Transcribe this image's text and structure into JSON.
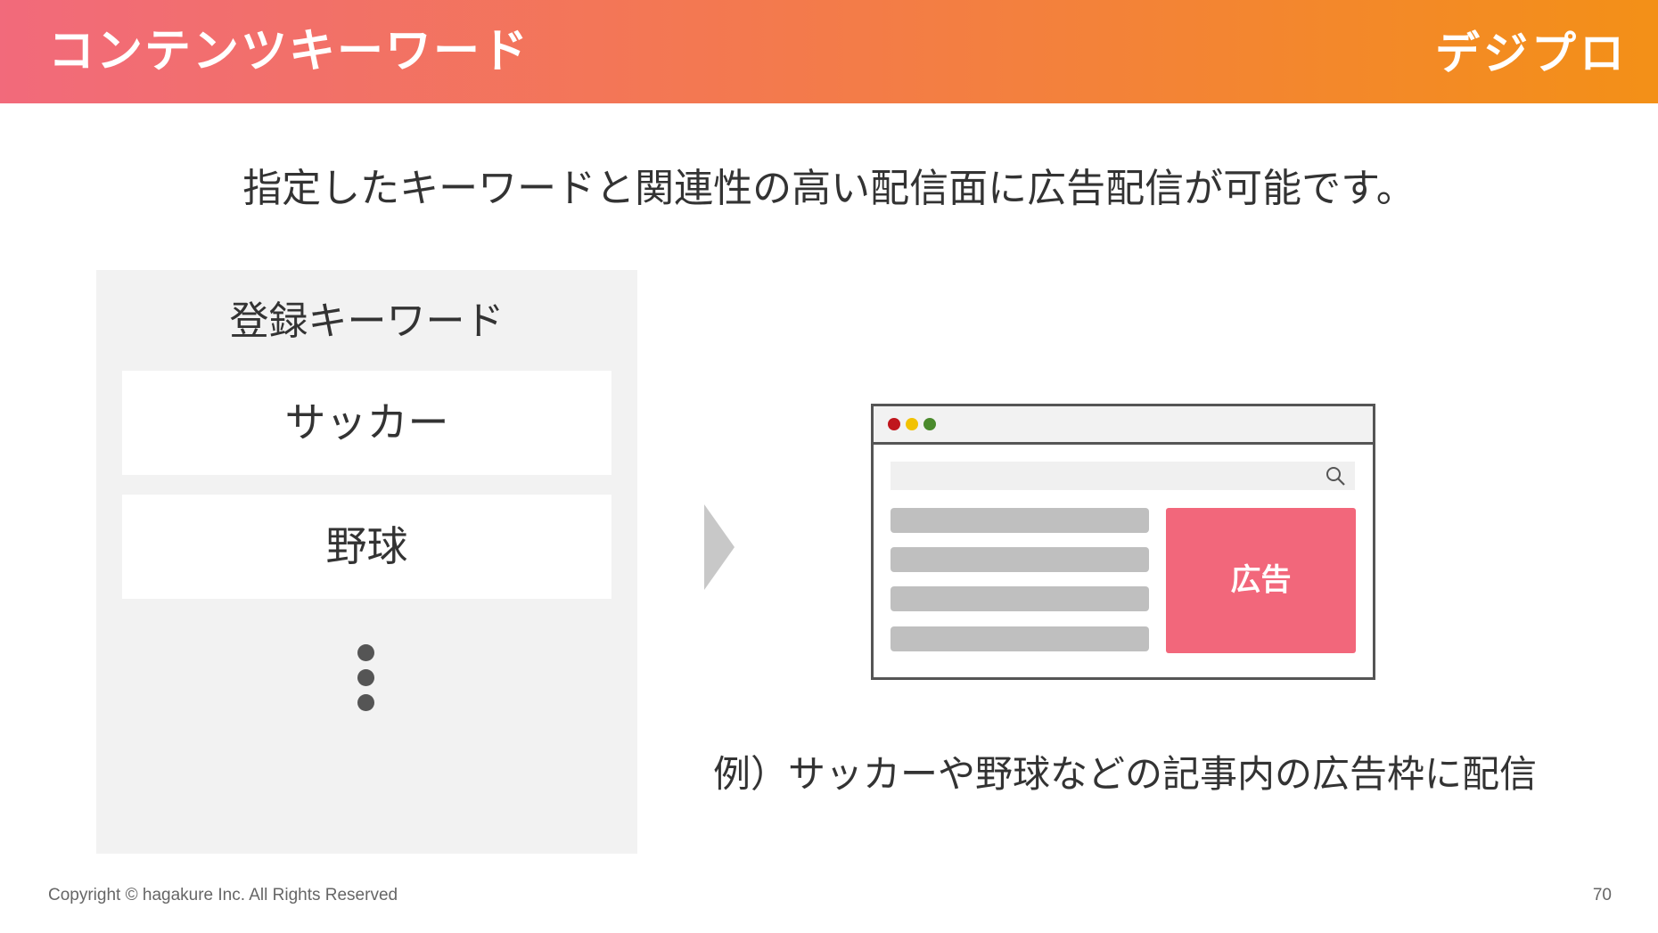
{
  "header": {
    "title": "コンテンツキーワード",
    "logo_text": "デジプロ"
  },
  "subtitle": "指定したキーワードと関連性の高い配信面に広告配信が可能です。",
  "keyword_panel": {
    "title": "登録キーワード",
    "keywords": [
      "サッカー",
      "野球"
    ]
  },
  "browser_mockup": {
    "ad_label": "広告",
    "window_dot_colors": [
      "#c0161d",
      "#f2c200",
      "#4a8a2c"
    ],
    "accent_color": "#f2677b"
  },
  "example_caption": "例）サッカーや野球などの記事内の広告枠に配信",
  "footer": {
    "copyright": "Copyright © hagakure Inc. All Rights Reserved",
    "page_number": "70"
  }
}
